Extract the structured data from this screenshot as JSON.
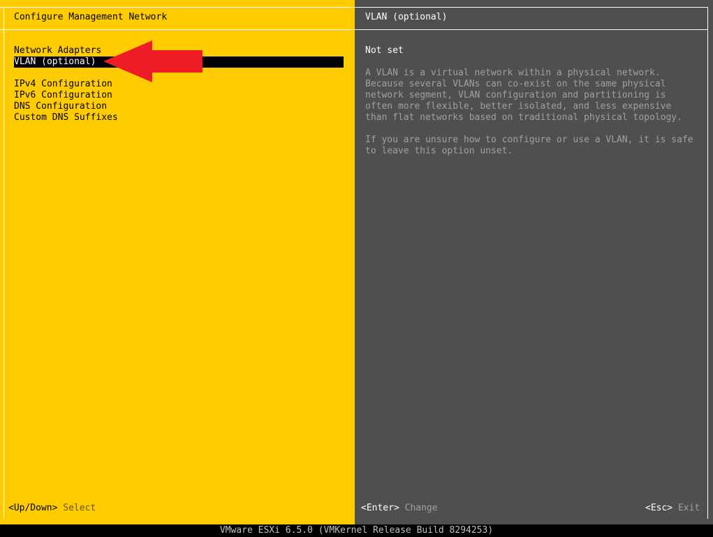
{
  "left_pane": {
    "title": "Configure Management Network",
    "menu_items": [
      {
        "label": "Network Adapters",
        "selected": false
      },
      {
        "label": "VLAN (optional)",
        "selected": true
      },
      {
        "label": "IPv4 Configuration",
        "selected": false
      },
      {
        "label": "IPv6 Configuration",
        "selected": false
      },
      {
        "label": "DNS Configuration",
        "selected": false
      },
      {
        "label": "Custom DNS Suffixes",
        "selected": false
      }
    ],
    "footer": {
      "key": "<Up/Down>",
      "action": "Select"
    }
  },
  "right_pane": {
    "title": "VLAN (optional)",
    "value": "Not set",
    "description_1": "A VLAN is a virtual network within a physical network.\nBecause several VLANs can co-exist on the same physical\nnetwork segment, VLAN configuration and partitioning is\noften more flexible, better isolated, and less expensive\nthan flat networks based on traditional physical topology.",
    "description_2": "If you are unsure how to configure or use a VLAN, it is safe\nto leave this option unset.",
    "footer_enter": {
      "key": "<Enter>",
      "action": "Change"
    },
    "footer_esc": {
      "key": "<Esc>",
      "action": "Exit"
    }
  },
  "status_bar": "VMware ESXi 6.5.0 (VMKernel Release Build 8294253)",
  "annotation": {
    "icon": "red-arrow-icon",
    "color": "#EE1C25"
  },
  "colors": {
    "left_background": "#FFCC00",
    "right_background": "#4F4F4F",
    "selection_background": "#000000"
  }
}
